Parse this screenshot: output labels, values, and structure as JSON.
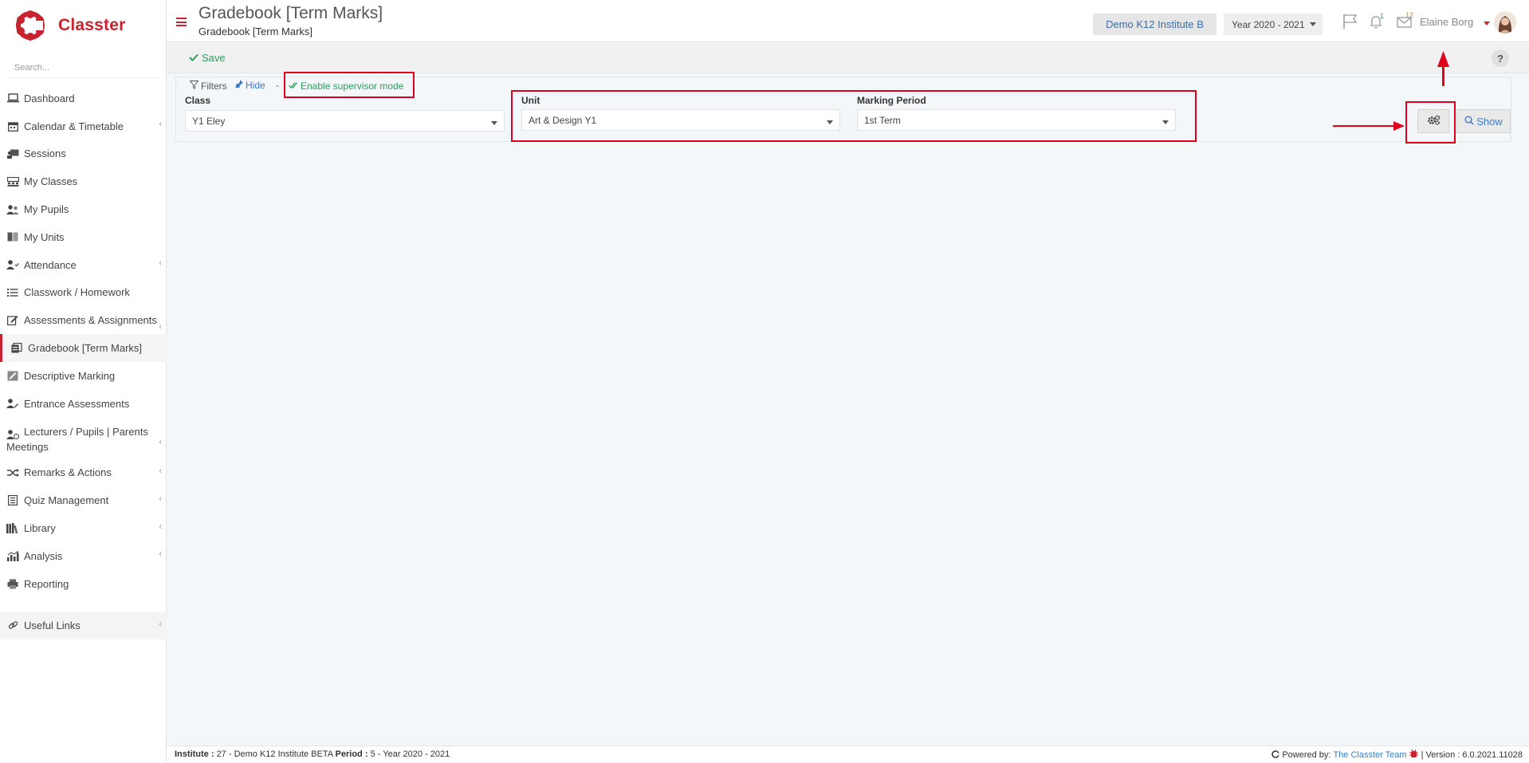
{
  "app": {
    "brand": "Classter"
  },
  "sidebar": {
    "search_placeholder": "Search...",
    "items": [
      {
        "label": "Dashboard",
        "icon": "laptop-icon"
      },
      {
        "label": "Calendar & Timetable",
        "icon": "calendar-icon",
        "has_submenu": true
      },
      {
        "label": "Sessions",
        "icon": "sessions-icon"
      },
      {
        "label": "My Classes",
        "icon": "classes-icon"
      },
      {
        "label": "My Pupils",
        "icon": "pupils-icon"
      },
      {
        "label": "My Units",
        "icon": "book-icon"
      },
      {
        "label": "Attendance",
        "icon": "attendance-icon",
        "has_submenu": true
      },
      {
        "label": "Classwork / Homework",
        "icon": "list-icon"
      },
      {
        "label": "Assessments & Assignments",
        "icon": "edit-icon",
        "has_submenu": true
      },
      {
        "label": "Gradebook [Term Marks]",
        "icon": "gradebook-icon",
        "active": true
      },
      {
        "label": "Descriptive Marking",
        "icon": "marking-icon"
      },
      {
        "label": "Entrance Assessments",
        "icon": "entrance-icon"
      },
      {
        "label": "Lecturers / Pupils | Parents Meetings",
        "icon": "meetings-icon",
        "has_submenu": true
      },
      {
        "label": "Remarks & Actions",
        "icon": "shuffle-icon",
        "has_submenu": true
      },
      {
        "label": "Quiz Management",
        "icon": "quiz-icon",
        "has_submenu": true
      },
      {
        "label": "Library",
        "icon": "library-icon",
        "has_submenu": true
      },
      {
        "label": "Analysis",
        "icon": "analysis-icon",
        "has_submenu": true
      },
      {
        "label": "Reporting",
        "icon": "printer-icon"
      },
      {
        "label": "Useful Links",
        "icon": "link-icon",
        "has_submenu": true
      }
    ]
  },
  "header": {
    "title": "Gradebook [Term Marks]",
    "subtitle": "Gradebook [Term Marks]",
    "institute": "Demo K12 Institute B",
    "year": "Year 2020 - 2021",
    "notifications_count": "1",
    "messages_count": "12",
    "user_name": "Elaine Borg"
  },
  "toolbar": {
    "save_label": "Save",
    "help_label": "?"
  },
  "filters": {
    "filters_label": "Filters",
    "hide_label": "Hide",
    "separator": "-",
    "supervisor_label": "Enable supervisor mode",
    "class_label": "Class",
    "class_value": "Y1 Eley",
    "unit_label": "Unit",
    "unit_value": "Art & Design Y1",
    "period_label": "Marking Period",
    "period_value": "1st Term",
    "show_label": "Show"
  },
  "footer": {
    "institute_label": "Institute :",
    "institute_value": "27 - Demo K12 Institute BETA",
    "period_label": "Period :",
    "period_value": "5 - Year 2020 - 2021",
    "powered_by": "Powered by:",
    "team_link": "The Classter Team",
    "version": "| Version : 6.0.2021.11028"
  },
  "colors": {
    "brand_red": "#c9232f",
    "link_blue": "#3a7bc8",
    "success_green": "#2e9e5b",
    "annotation_red": "#e0001b"
  }
}
